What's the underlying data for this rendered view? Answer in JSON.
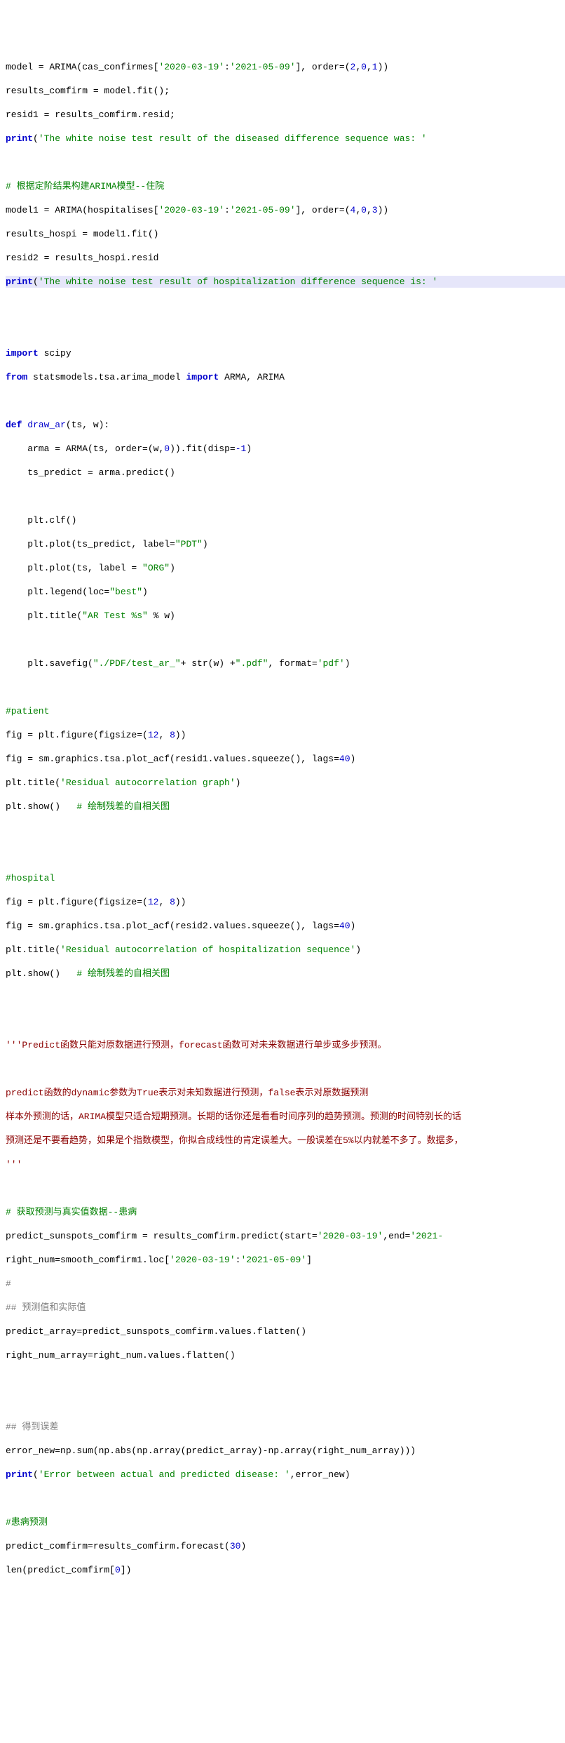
{
  "code": {
    "l01a": "model = ARIMA(cas_confirmes[",
    "l01b": "'2020-03-19'",
    "l01c": ":",
    "l01d": "'2021-05-09'",
    "l01e": "], order=(",
    "l01f": "2",
    "l01g": ",",
    "l01h": "0",
    "l01i": ",",
    "l01j": "1",
    "l01k": "))",
    "l02": "results_comfirm = model.fit();",
    "l03": "resid1 = results_comfirm.resid;",
    "l04a": "print",
    "l04b": "(",
    "l04c": "'The white noise test result of the diseased difference sequence was: '",
    "l06": "# 根据定阶结果构建ARIMA模型--住院",
    "l07a": "model1 = ARIMA(hospitalises[",
    "l07b": "'2020-03-19'",
    "l07c": ":",
    "l07d": "'2021-05-09'",
    "l07e": "], order=(",
    "l07f": "4",
    "l07g": ",",
    "l07h": "0",
    "l07i": ",",
    "l07j": "3",
    "l07k": "))",
    "l08": "results_hospi = model1.fit()",
    "l09": "resid2 = results_hospi.resid",
    "l10a": "print",
    "l10b": "(",
    "l10c": "'The white noise test result of hospitalization difference sequence is: '",
    "l13a": "import",
    "l13b": " scipy",
    "l14a": "from",
    "l14b": " statsmodels.tsa.arima_model ",
    "l14c": "import",
    "l14d": " ARMA, ARIMA",
    "l16a": "def",
    "l16b": " ",
    "l16c": "draw_ar",
    "l16d": "(ts, w):",
    "l17a": "    arma = ARMA(ts, order=(w,",
    "l17b": "0",
    "l17c": ")).fit(disp=",
    "l17d": "-1",
    "l17e": ")",
    "l18": "    ts_predict = arma.predict()",
    "l20": "    plt.clf()",
    "l21a": "    plt.plot(ts_predict, label=",
    "l21b": "\"PDT\"",
    "l21c": ")",
    "l22a": "    plt.plot(ts, label = ",
    "l22b": "\"ORG\"",
    "l22c": ")",
    "l23a": "    plt.legend(loc=",
    "l23b": "\"best\"",
    "l23c": ")",
    "l24a": "    plt.title(",
    "l24b": "\"AR Test %s\"",
    "l24c": " % w)",
    "l26a": "    plt.savefig(",
    "l26b": "\"./PDF/test_ar_\"",
    "l26c": "+ str(w) +",
    "l26d": "\".pdf\"",
    "l26e": ", format=",
    "l26f": "'pdf'",
    "l26g": ")",
    "l28": "#patient",
    "l29a": "fig = plt.figure(figsize=(",
    "l29b": "12",
    "l29c": ", ",
    "l29d": "8",
    "l29e": "))",
    "l30a": "fig = sm.graphics.tsa.plot_acf(resid1.values.squeeze(), lags=",
    "l30b": "40",
    "l30c": ")",
    "l31a": "plt.title(",
    "l31b": "'Residual autocorrelation graph'",
    "l31c": ")",
    "l32a": "plt.show()   ",
    "l32b": "# 绘制残差的自相关图",
    "l35": "#hospital",
    "l36a": "fig = plt.figure(figsize=(",
    "l36b": "12",
    "l36c": ", ",
    "l36d": "8",
    "l36e": "))",
    "l37a": "fig = sm.graphics.tsa.plot_acf(resid2.values.squeeze(), lags=",
    "l37b": "40",
    "l37c": ")",
    "l38a": "plt.title(",
    "l38b": "'Residual autocorrelation of hospitalization sequence'",
    "l38c": ")",
    "l39a": "plt.show()   ",
    "l39b": "# 绘制残差的自相关图",
    "l42": "'''Predict函数只能对原数据进行预测，forecast函数可对未来数据进行单步或多步预测。",
    "l44": "predict函数的dynamic参数为True表示对未知数据进行预测，false表示对原数据预测",
    "l45": "样本外预测的话，ARIMA模型只适合短期预测。长期的话你还是看看时间序列的趋势预测。预测的时间特别长的话",
    "l46": "预测还是不要看趋势，如果是个指数模型，你拟合成线性的肯定误差大。一般误差在5%以内就差不多了。数据多，",
    "l47": "'''",
    "l49": "# 获取预测与真实值数据--患病",
    "l50a": "predict_sunspots_comfirm = results_comfirm.predict(start=",
    "l50b": "'2020-03-19'",
    "l50c": ",end=",
    "l50d": "'2021-",
    "l51a": "right_num=smooth_comfirm1.loc[",
    "l51b": "'2020-03-19'",
    "l51c": ":",
    "l51d": "'2021-05-09'",
    "l51e": "]",
    "l52": "#",
    "l53": "## 预测值和实际值",
    "l54": "predict_array=predict_sunspots_comfirm.values.flatten()",
    "l55": "right_num_array=right_num.values.flatten()",
    "l58": "## 得到误差",
    "l59": "error_new=np.sum(np.abs(np.array(predict_array)-np.array(right_num_array)))",
    "l60a": "print",
    "l60b": "(",
    "l60c": "'Error between actual and predicted disease: '",
    "l60d": ",error_new)",
    "l62": "#患病预测",
    "l63a": "predict_comfirm=results_comfirm.forecast(",
    "l63b": "30",
    "l63c": ")",
    "l64a": "len(predict_comfirm[",
    "l64b": "0",
    "l64c": "])"
  }
}
